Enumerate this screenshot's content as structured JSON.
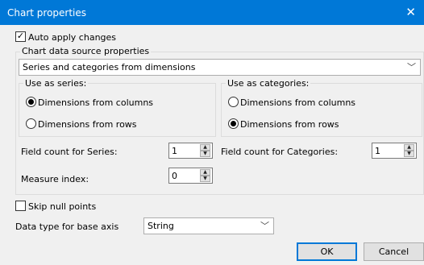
{
  "window": {
    "title": "Chart properties",
    "close_glyph": "✕"
  },
  "auto_apply": {
    "label": "Auto apply changes",
    "checked": true
  },
  "datasource_group": {
    "label": "Chart data source properties"
  },
  "datasource_select": {
    "value": "Series and categories from dimensions"
  },
  "series_group": {
    "label": "Use as series:",
    "options": [
      {
        "label": "Dimensions from columns",
        "selected": true
      },
      {
        "label": "Dimensions from rows",
        "selected": false
      }
    ]
  },
  "categories_group": {
    "label": "Use as categories:",
    "options": [
      {
        "label": "Dimensions from columns",
        "selected": false
      },
      {
        "label": "Dimensions from rows",
        "selected": true
      }
    ]
  },
  "field_count_series": {
    "label": "Field count for Series:",
    "value": "1"
  },
  "field_count_categories": {
    "label": "Field count for Categories:",
    "value": "1"
  },
  "measure_index": {
    "label": "Measure index:",
    "value": "0"
  },
  "skip_null": {
    "label": "Skip null points",
    "checked": false
  },
  "data_type": {
    "label": "Data type for base axis",
    "value": "String"
  },
  "buttons": {
    "ok": "OK",
    "cancel": "Cancel"
  },
  "colors": {
    "titlebar": "#0078d7",
    "background": "#f0f0f0",
    "accent_border": "#0078d7"
  },
  "icons": {
    "close": "close-icon",
    "chevron": "chevron-down-icon",
    "spin_up": "spin-up-icon",
    "spin_down": "spin-down-icon"
  }
}
